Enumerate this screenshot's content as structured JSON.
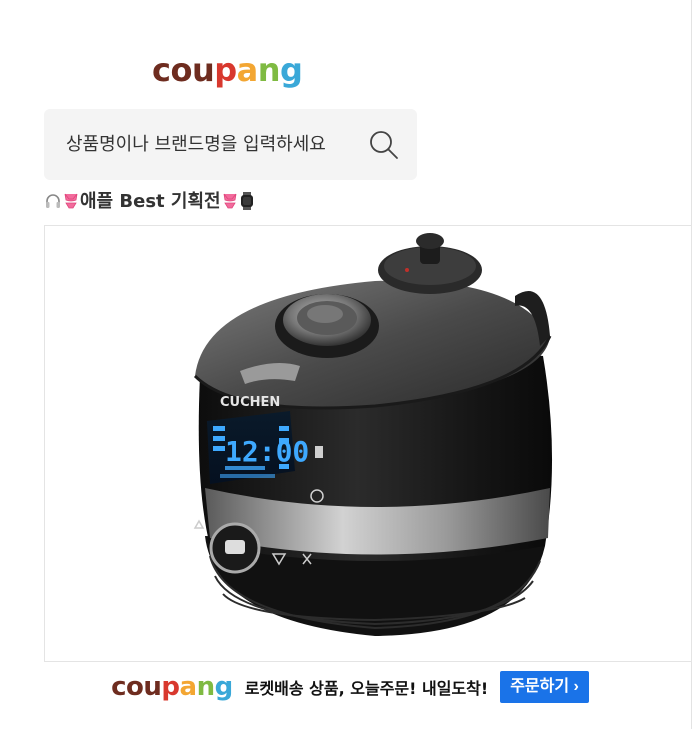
{
  "brand": {
    "name": "coupang",
    "letters": [
      {
        "ch": "c",
        "color": "#6e2c1f"
      },
      {
        "ch": "o",
        "color": "#6e2c1f"
      },
      {
        "ch": "u",
        "color": "#6e2c1f"
      },
      {
        "ch": "p",
        "color": "#d8382e"
      },
      {
        "ch": "a",
        "color": "#f3a632"
      },
      {
        "ch": "n",
        "color": "#7fba42"
      },
      {
        "ch": "g",
        "color": "#3aa8d8"
      }
    ]
  },
  "search": {
    "placeholder": "상품명이나 브랜드명을 입력하세요"
  },
  "promo": {
    "title": "애플 Best 기획전"
  },
  "product": {
    "brand_text": "CUCHEN",
    "display_time": "12:00"
  },
  "banner": {
    "text": "로켓배송 상품, 오늘주문! 내일도착!",
    "button_label": "주문하기",
    "button_arrow": "›",
    "button_color": "#1a73e8"
  }
}
